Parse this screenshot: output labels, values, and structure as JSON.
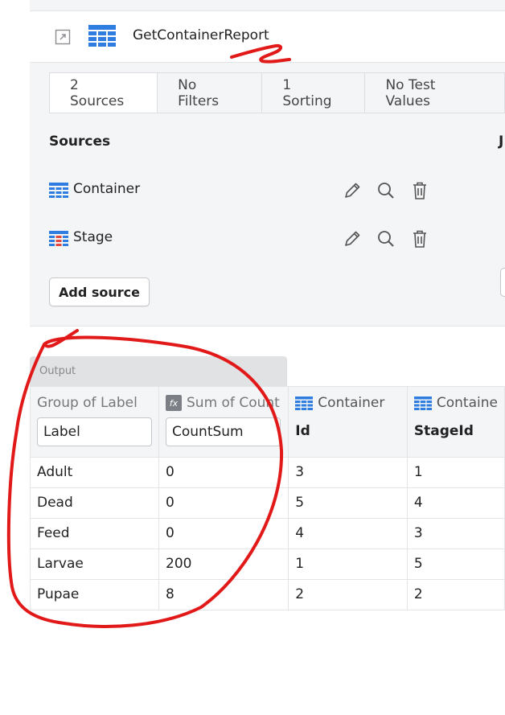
{
  "query": {
    "title": "GetContainerReport"
  },
  "tabs": [
    {
      "label": "2 Sources",
      "active": true
    },
    {
      "label": "No Filters",
      "active": false
    },
    {
      "label": "1 Sorting",
      "active": false
    },
    {
      "label": "No Test Values",
      "active": false
    }
  ],
  "sources_panel": {
    "heading": "Sources",
    "joins_heading_partial": "J",
    "items": [
      {
        "name": "Container",
        "icon": "blue-table-icon"
      },
      {
        "name": "Stage",
        "icon": "red-blue-table-icon"
      }
    ],
    "add_label": "Add source"
  },
  "output": {
    "label": "Output",
    "columns": [
      {
        "caption": "Group of Label",
        "input_value": "Label"
      },
      {
        "caption": "Sum of Count",
        "input_value": "CountSum",
        "icon": "fx-icon"
      },
      {
        "caption": "Container",
        "field": "Id",
        "icon": "table-icon"
      },
      {
        "caption": "Containe",
        "field": "StageId",
        "icon": "table-icon"
      }
    ],
    "rows": [
      [
        "Adult",
        "0",
        "3",
        "1"
      ],
      [
        "Dead",
        "0",
        "5",
        "4"
      ],
      [
        "Feed",
        "0",
        "4",
        "3"
      ],
      [
        "Larvae",
        "200",
        "1",
        "5"
      ],
      [
        "Pupae",
        "8",
        "2",
        "2"
      ]
    ]
  },
  "colors": {
    "accent_blue": "#2f7de1",
    "annotation_red": "#e11919",
    "panel_bg": "#f4f5f7"
  }
}
